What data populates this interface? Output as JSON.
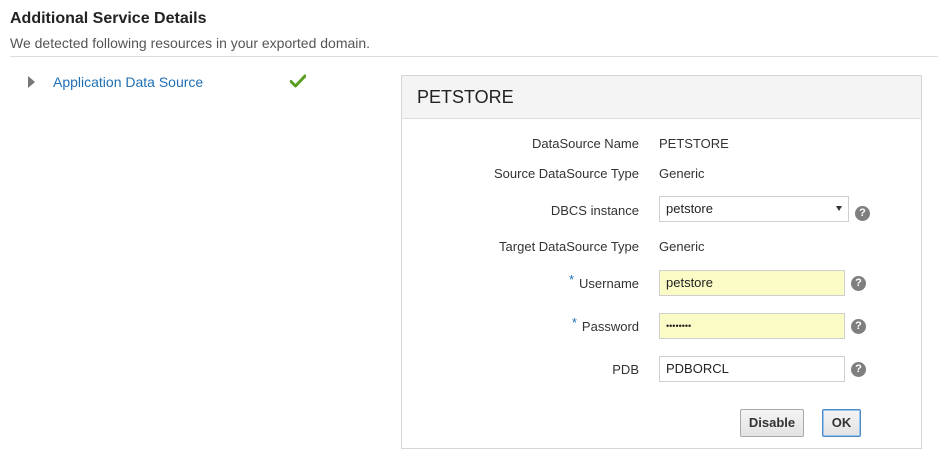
{
  "header": {
    "title": "Additional Service Details",
    "subtitle": "We detected following resources in your exported domain."
  },
  "tree": {
    "items": [
      {
        "label": "Application Data Source",
        "status_icon": "check-icon",
        "status_color": "#5a9e1f"
      }
    ]
  },
  "panel": {
    "title": "PETSTORE",
    "fields": {
      "datasource_name": {
        "label": "DataSource Name",
        "value": "PETSTORE"
      },
      "source_type": {
        "label": "Source DataSource Type",
        "value": "Generic"
      },
      "dbcs_instance": {
        "label": "DBCS instance",
        "value": "petstore"
      },
      "target_type": {
        "label": "Target DataSource Type",
        "value": "Generic"
      },
      "username": {
        "label": "Username",
        "required_mark": "*",
        "value": "petstore"
      },
      "password": {
        "label": "Password",
        "required_mark": "*",
        "value": "••••••••"
      },
      "pdb": {
        "label": "PDB",
        "value": "PDBORCL"
      }
    },
    "help_glyph": "?",
    "buttons": {
      "disable": "Disable",
      "ok": "OK"
    }
  },
  "colors": {
    "link": "#1f6fb5",
    "required": "#1f6fb5",
    "highlight_field": "#fbfbc6",
    "check": "#5a9e1f"
  }
}
